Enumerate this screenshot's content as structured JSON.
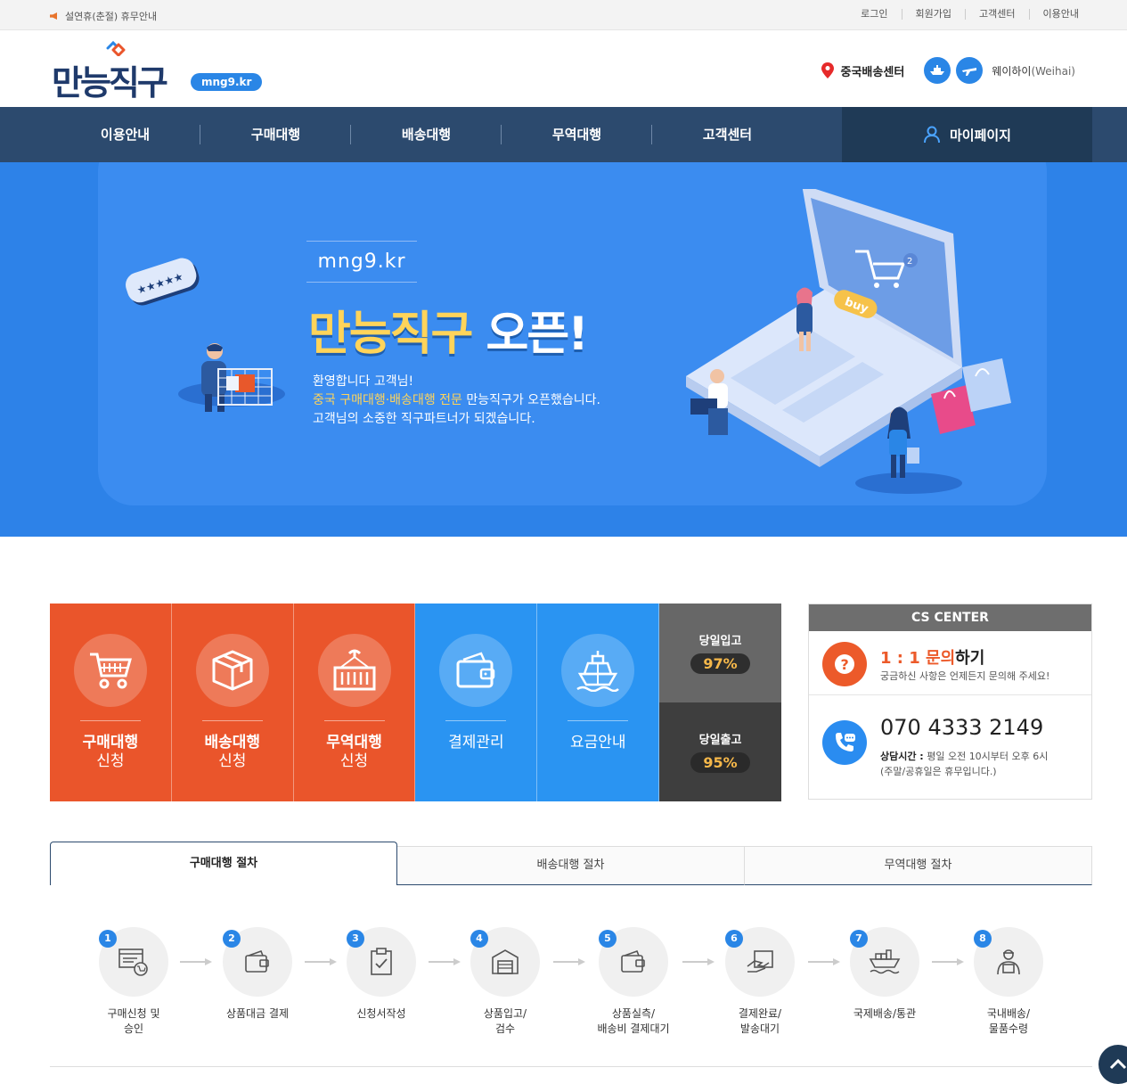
{
  "topbar": {
    "notice": "설연휴(춘절) 휴무안내",
    "links": [
      "로그인",
      "회원가입",
      "고객센터",
      "이용안내"
    ]
  },
  "header": {
    "logo_text": "만능직구",
    "logo_badge": "mng9.kr",
    "center_label": "중국배송센터",
    "city": "웨이하이",
    "city_en": "(Weihai)"
  },
  "nav": {
    "items": [
      "이용안내",
      "구매대행",
      "배송대행",
      "무역대행",
      "고객센터"
    ],
    "mypage": "마이페이지"
  },
  "hero": {
    "domain": "mng9.kr",
    "title_main": "만능직구",
    "title_tail": " 오픈!",
    "line1": "환영합니다 고객님!",
    "line2_highlight": "중국 구매대행·배송대행 전문",
    "line2_rest": " 만능직구가 오픈했습니다.",
    "line3": "고객님의 소중한 직구파트너가 되겠습니다."
  },
  "quick": [
    {
      "icon": "cart-icon",
      "label": "구매대행",
      "sub": "신청"
    },
    {
      "icon": "box-icon",
      "label": "배송대행",
      "sub": "신청"
    },
    {
      "icon": "container-icon",
      "label": "무역대행",
      "sub": "신청"
    },
    {
      "icon": "wallet-icon",
      "label": "결제관리",
      "sub": ""
    },
    {
      "icon": "ship-icon",
      "label": "요금안내",
      "sub": ""
    }
  ],
  "stats": [
    {
      "title": "당일입고",
      "value": "97%"
    },
    {
      "title": "당일출고",
      "value": "95%"
    }
  ],
  "cs": {
    "title": "CS CENTER",
    "inquiry_highlight": "1 : 1 문의",
    "inquiry_rest": "하기",
    "inquiry_sub": "궁금하신 사항은 언제든지 문의해 주세요!",
    "phone": "070 4333 2149",
    "hours_label": "상담시간 :",
    "hours": " 평일 오전 10시부터 오후 6시",
    "hours_note": "(주말/공휴일은 휴무입니다.)"
  },
  "tabs": [
    "구매대행 절차",
    "배송대행 절차",
    "무역대행 절차"
  ],
  "steps": [
    {
      "num": "1",
      "label": "구매신청 및\n승인",
      "icon": "order-icon"
    },
    {
      "num": "2",
      "label": "상품대금 결제",
      "icon": "wallet-icon"
    },
    {
      "num": "3",
      "label": "신청서작성",
      "icon": "clipboard-icon"
    },
    {
      "num": "4",
      "label": "상품입고/\n검수",
      "icon": "warehouse-icon"
    },
    {
      "num": "5",
      "label": "상품실측/\n배송비 결제대기",
      "icon": "wallet-icon"
    },
    {
      "num": "6",
      "label": "결제완료/\n발송대기",
      "icon": "payment-hand-icon"
    },
    {
      "num": "7",
      "label": "국제배송/통관",
      "icon": "ship-icon"
    },
    {
      "num": "8",
      "label": "국내배송/\n물품수령",
      "icon": "courier-icon"
    }
  ],
  "colors": {
    "navy": "#2c4a6e",
    "orange": "#ea552b",
    "blue": "#2a94f2",
    "hero": "#2d82e8",
    "yellow": "#ffd45a"
  }
}
